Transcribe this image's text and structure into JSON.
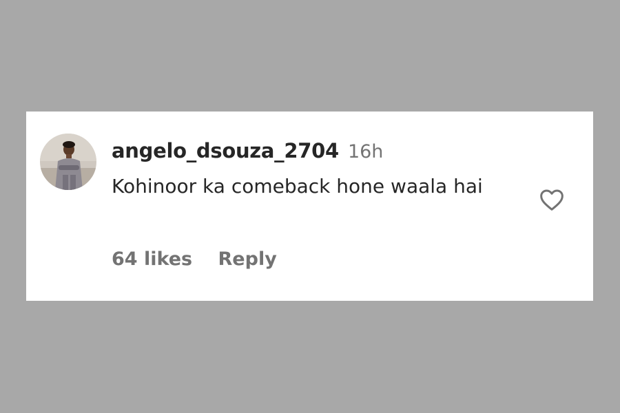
{
  "comment": {
    "username": "angelo_dsouza_2704",
    "timestamp": "16h",
    "text": "Kohinoor ka comeback hone waala hai",
    "likes": "64 likes",
    "reply_label": "Reply"
  },
  "icons": {
    "like": "heart-outline-icon",
    "avatar": "user-profile-photo"
  },
  "colors": {
    "background": "#a8a8a8",
    "card": "#ffffff",
    "primary_text": "#262626",
    "secondary_text": "#737373"
  }
}
